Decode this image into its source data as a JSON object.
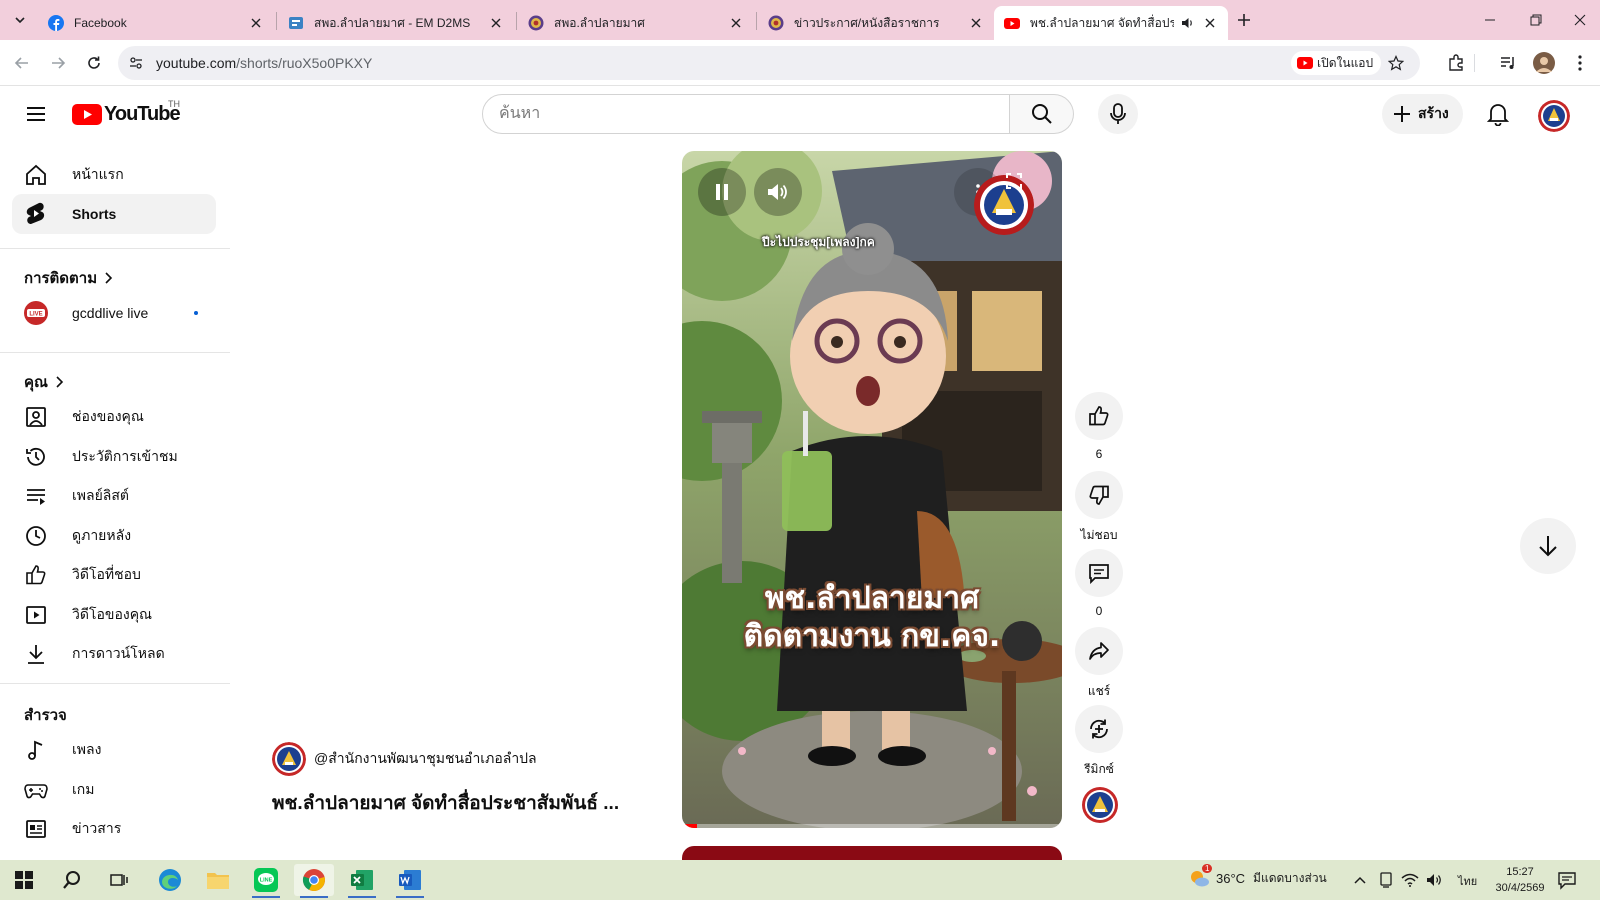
{
  "browser": {
    "tabs": [
      {
        "title": "Facebook",
        "favicon": "facebook-icon",
        "active": false
      },
      {
        "title": "สพอ.ลำปลายมาศ - EM D2MS",
        "favicon": "d2ms-icon",
        "active": false
      },
      {
        "title": "สพอ.ลำปลายมาศ",
        "favicon": "seal-icon",
        "active": false
      },
      {
        "title": "ข่าวประกาศ/หนังสือราชการ",
        "favicon": "seal-icon",
        "active": false
      },
      {
        "title": "พช.ลำปลายมาศ จัดทำสื่อประชา",
        "favicon": "youtube-icon",
        "active": true,
        "audio": true
      }
    ],
    "url_host": "youtube.com",
    "url_path": "/shorts/ruoX5o0PKXY",
    "open_in_app": "เปิดในแอป",
    "colors": {
      "tabstrip": "#f2cfdc",
      "accent_red": "#ff0000"
    }
  },
  "youtube": {
    "logo_text": "YouTube",
    "country_code": "TH",
    "search_placeholder": "ค้นหา",
    "create_label": "สร้าง",
    "sidebar": {
      "main": [
        {
          "label": "หน้าแรก",
          "icon": "home-icon"
        },
        {
          "label": "Shorts",
          "icon": "shorts-icon",
          "active": true
        }
      ],
      "subscriptions_header": "การติดตาม",
      "subscriptions": [
        {
          "label": "gcddlive live",
          "icon": "channel-avatar",
          "live": true
        }
      ],
      "you_header": "คุณ",
      "you": [
        {
          "label": "ช่องของคุณ",
          "icon": "your-channel-icon"
        },
        {
          "label": "ประวัติการเข้าชม",
          "icon": "history-icon"
        },
        {
          "label": "เพลย์ลิสต์",
          "icon": "playlist-icon"
        },
        {
          "label": "ดูภายหลัง",
          "icon": "watch-later-icon"
        },
        {
          "label": "วิดีโอที่ชอบ",
          "icon": "liked-icon"
        },
        {
          "label": "วิดีโอของคุณ",
          "icon": "your-videos-icon"
        },
        {
          "label": "การดาวน์โหลด",
          "icon": "download-icon"
        }
      ],
      "explore_header": "สำรวจ",
      "explore": [
        {
          "label": "เพลง",
          "icon": "music-icon"
        },
        {
          "label": "เกม",
          "icon": "gaming-icon"
        },
        {
          "label": "ข่าวสาร",
          "icon": "news-icon"
        }
      ]
    },
    "short": {
      "song": "ปีะไปประชุม[เพลง]กค",
      "overlay_line1": "พช.ลำปลายมาศ",
      "overlay_line2": "ติดตามงาน กข.คจ.",
      "channel": "@สำนักงานพัฒนาชุมชนอำเภอลำปล",
      "title": "พช.ลำปลายมาศ จัดทำสื่อประชาสัมพันธ์ ...",
      "progress": 0.04
    },
    "actions": {
      "like_count": "6",
      "dislike_label": "ไม่ชอบ",
      "comment_count": "0",
      "share_label": "แชร์",
      "remix_label": "รีมิกซ์"
    }
  },
  "taskbar": {
    "temperature": "36°C",
    "weather": "มีแดดบางส่วน",
    "weather_badge": "1",
    "language": "ไทย",
    "time": "15:27",
    "date": "30/4/2569"
  }
}
